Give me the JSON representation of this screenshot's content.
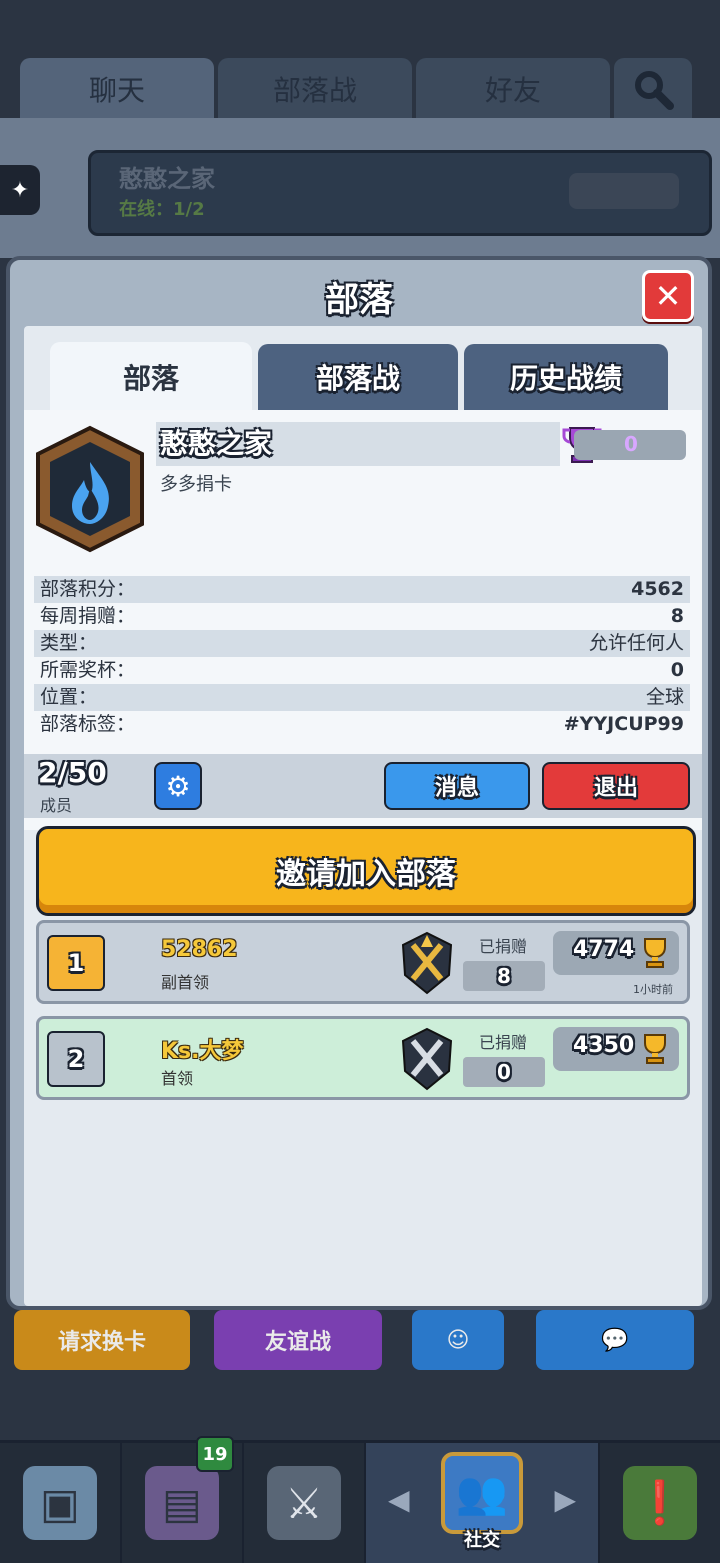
{
  "top_tabs": [
    "聊天",
    "部落战",
    "好友"
  ],
  "bg_clan": {
    "name": "憨憨之家",
    "online": "在线：1/2",
    "trophies": "0"
  },
  "modal": {
    "title": "部落",
    "tabs": [
      "部落",
      "部落战",
      "历史战绩"
    ],
    "clan": {
      "name": "憨憨之家",
      "description": "多多捐卡",
      "trophies": "0",
      "info": [
        {
          "key": "部落积分：",
          "value": "4562"
        },
        {
          "key": "每周捐赠：",
          "value": "8"
        },
        {
          "key": "类型：",
          "value": "允许任何人"
        },
        {
          "key": "所需奖杯：",
          "value": "0"
        },
        {
          "key": "位置：",
          "value": "全球"
        },
        {
          "key": "部落标签：",
          "value": "#YYJCUP99"
        }
      ]
    },
    "members_count": "2/50",
    "members_label": "成员",
    "message_button": "消息",
    "exit_button": "退出",
    "invite_button": "邀请加入部落",
    "members": [
      {
        "rank": "1",
        "name": "52862",
        "role": "副首领",
        "donated_label": "已捐赠",
        "donated": "8",
        "trophies": "4774",
        "last_seen": "1小时前"
      },
      {
        "rank": "2",
        "name": "Ks.大梦",
        "role": "首领",
        "donated_label": "已捐赠",
        "donated": "0",
        "trophies": "4350"
      }
    ]
  },
  "bg_buttons": [
    "请求换卡",
    "友谊战"
  ],
  "bottom_nav": {
    "cards_badge": "19",
    "social_label": "社交"
  },
  "colors": {
    "accent_orange": "#f7b51c",
    "message_blue": "#3a98ec",
    "exit_red": "#e33a3a",
    "leader_row_green": "#cdeed9"
  }
}
